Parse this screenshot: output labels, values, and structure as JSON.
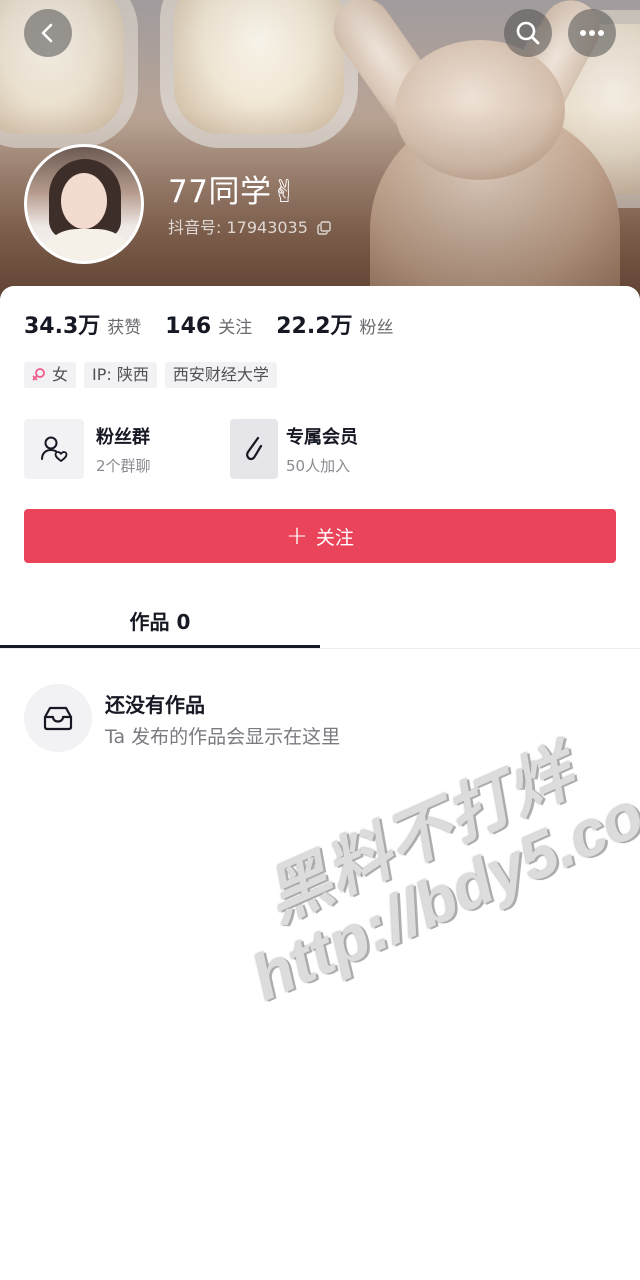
{
  "header": {
    "username": "77同学✌",
    "douyin_id": "抖音号: 17943035"
  },
  "stats": [
    {
      "value": "34.3万",
      "label": "获赞"
    },
    {
      "value": "146",
      "label": "关注"
    },
    {
      "value": "22.2万",
      "label": "粉丝"
    }
  ],
  "tags": {
    "gender": "女",
    "ip": "IP: 陕西",
    "school": "西安财经大学"
  },
  "features": {
    "fans_group": {
      "title": "粉丝群",
      "subtitle": "2个群聊"
    },
    "membership": {
      "title": "专属会员",
      "subtitle": "50人加入"
    }
  },
  "follow_button": {
    "label": "关注"
  },
  "tabs": [
    {
      "label": "作品 0"
    }
  ],
  "empty_state": {
    "title": "还没有作品",
    "description": "Ta 发布的作品会显示在这里"
  },
  "watermark": {
    "line1": "黑料不打烊",
    "line2": "http://bdy5.co"
  },
  "colors": {
    "accent": "#ea445a",
    "text_primary": "#161823",
    "text_secondary": "#6b6b6f"
  }
}
